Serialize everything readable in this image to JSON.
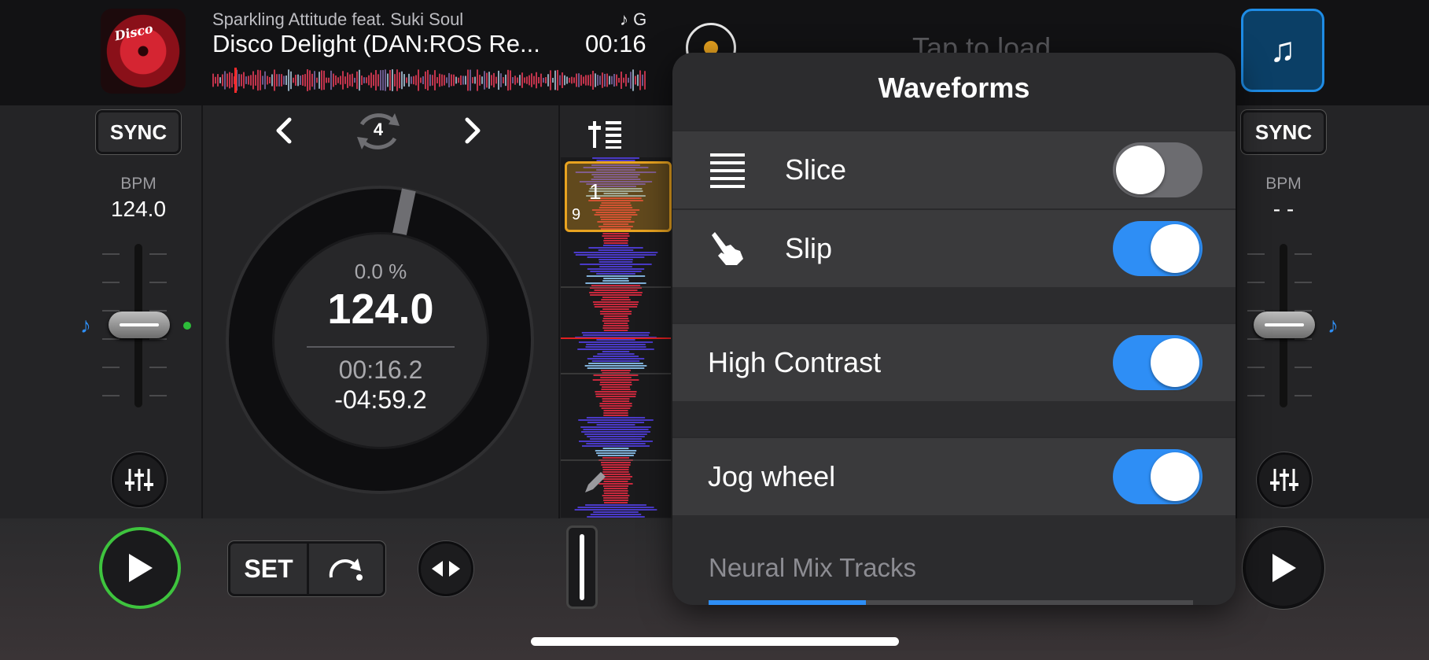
{
  "deck_a": {
    "artist": "Sparkling Attitude feat. Suki Soul",
    "title": "Disco Delight (DAN:ROS Re...",
    "key": "♪ G",
    "time": "00:16",
    "sync_label": "SYNC",
    "bpm_label": "BPM",
    "bpm_value": "124.0",
    "jog": {
      "pitch": "0.0 %",
      "bpm": "124.0",
      "elapsed": "00:16.2",
      "remaining": "-04:59.2"
    },
    "loop_size": "4",
    "set_label": "SET"
  },
  "deck_b": {
    "load_text": "Tap to load",
    "sync_label": "SYNC",
    "bpm_label": "BPM",
    "bpm_value": "- -"
  },
  "waveform_strip": {
    "cue_number": "1",
    "beat_count": "9"
  },
  "popup": {
    "title": "Waveforms",
    "rows": [
      {
        "label": "Slice",
        "icon": "slice-lines-icon",
        "on": false
      },
      {
        "label": "Slip",
        "icon": "hand-pointer-icon",
        "on": true
      },
      {
        "label": "High Contrast",
        "on": true
      },
      {
        "label": "Jog wheel",
        "on": true
      }
    ],
    "section": "Neural Mix Tracks"
  },
  "colors": {
    "accent_blue": "#2e8ef5",
    "play_ring": "#3ec43e",
    "cue_orange": "#e8a320"
  }
}
